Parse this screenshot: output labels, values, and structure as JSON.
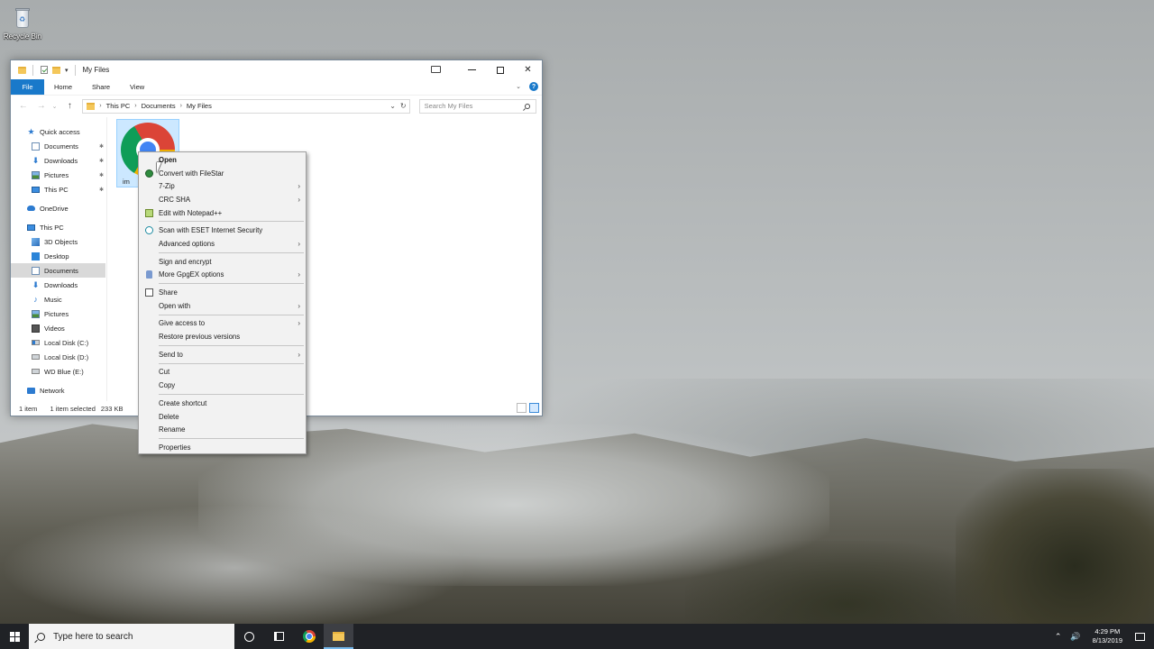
{
  "desktop": {
    "recycle_bin_label": "Recycle Bin"
  },
  "window": {
    "title": "My Files",
    "qa_dropdown": "▾",
    "controls": {
      "minimize": "—",
      "maximize": "☐",
      "close": "✕"
    }
  },
  "ribbon": {
    "tabs": [
      "File",
      "Home",
      "Share",
      "View"
    ],
    "expand": "⌄",
    "help": "?"
  },
  "address": {
    "back": "←",
    "forward": "→",
    "recent": "⌄",
    "up": "↑",
    "crumbs": [
      "This PC",
      "Documents",
      "My Files"
    ],
    "separator": "›",
    "dropdown": "⌄",
    "refresh": "↻",
    "search_placeholder": "Search My Files"
  },
  "nav_pane": {
    "items": [
      {
        "label": "Quick access",
        "icon": "star-icon",
        "level": 0
      },
      {
        "label": "Documents",
        "icon": "documents-icon",
        "level": 1,
        "pinned": true
      },
      {
        "label": "Downloads",
        "icon": "downloads-icon",
        "level": 1,
        "pinned": true
      },
      {
        "label": "Pictures",
        "icon": "pictures-icon",
        "level": 1,
        "pinned": true
      },
      {
        "label": "This PC",
        "icon": "pc-icon",
        "level": 1,
        "pinned": true
      },
      {
        "label": "OneDrive",
        "icon": "onedrive-icon",
        "level": 0
      },
      {
        "label": "This PC",
        "icon": "pc-icon",
        "level": 0
      },
      {
        "label": "3D Objects",
        "icon": "3d-objects-icon",
        "level": 1
      },
      {
        "label": "Desktop",
        "icon": "desktop-icon",
        "level": 1
      },
      {
        "label": "Documents",
        "icon": "documents-icon",
        "level": 1,
        "selected": true
      },
      {
        "label": "Downloads",
        "icon": "downloads-icon",
        "level": 1
      },
      {
        "label": "Music",
        "icon": "music-icon",
        "level": 1
      },
      {
        "label": "Pictures",
        "icon": "pictures-icon",
        "level": 1
      },
      {
        "label": "Videos",
        "icon": "videos-icon",
        "level": 1
      },
      {
        "label": "Local Disk (C:)",
        "icon": "local-disk-c-icon",
        "level": 1
      },
      {
        "label": "Local Disk (D:)",
        "icon": "local-disk-icon",
        "level": 1
      },
      {
        "label": "WD Blue (E:)",
        "icon": "usb-drive-icon",
        "level": 1
      },
      {
        "label": "Network",
        "icon": "network-icon",
        "level": 0
      }
    ],
    "pin_glyph": "📌"
  },
  "content": {
    "file": {
      "name": "im",
      "icon": "chrome-icon"
    }
  },
  "status": {
    "item_count": "1 item",
    "selection": "1 item selected",
    "size": "233 KB"
  },
  "context_menu": {
    "arrow_glyph": "›",
    "groups": [
      [
        {
          "label": "Open",
          "bold": true
        },
        {
          "label": "Convert with FileStar",
          "icon": "filestar-icon"
        },
        {
          "label": "7-Zip",
          "submenu": true
        },
        {
          "label": "CRC SHA",
          "submenu": true
        },
        {
          "label": "Edit with Notepad++",
          "icon": "notepad-plus-plus-icon"
        }
      ],
      [
        {
          "label": "Scan with ESET Internet Security",
          "icon": "eset-icon"
        },
        {
          "label": "Advanced options",
          "submenu": true
        }
      ],
      [
        {
          "label": "Sign and encrypt"
        },
        {
          "label": "More GpgEX options",
          "icon": "lock-icon",
          "submenu": true
        }
      ],
      [
        {
          "label": "Share",
          "icon": "share-icon"
        },
        {
          "label": "Open with",
          "submenu": true
        }
      ],
      [
        {
          "label": "Give access to",
          "submenu": true
        },
        {
          "label": "Restore previous versions"
        }
      ],
      [
        {
          "label": "Send to",
          "submenu": true
        }
      ],
      [
        {
          "label": "Cut"
        },
        {
          "label": "Copy"
        }
      ],
      [
        {
          "label": "Create shortcut"
        },
        {
          "label": "Delete"
        },
        {
          "label": "Rename"
        }
      ],
      [
        {
          "label": "Properties"
        }
      ]
    ]
  },
  "taskbar": {
    "search_placeholder": "Type here to search",
    "tray": {
      "chevron": "⌃",
      "volume": "🔊",
      "time": "4:29 PM",
      "date": "8/13/2019"
    }
  }
}
